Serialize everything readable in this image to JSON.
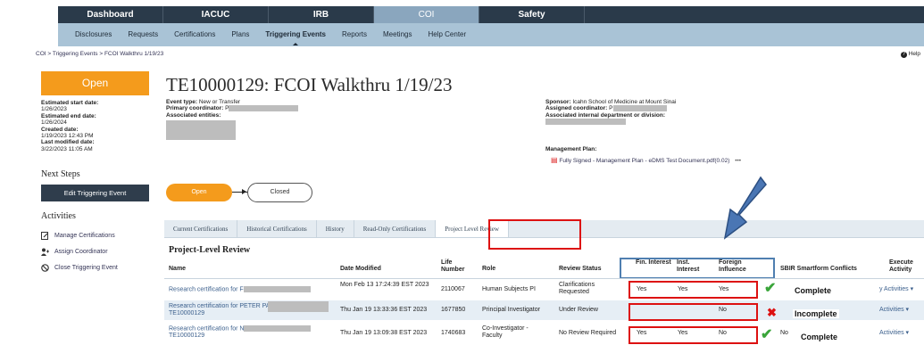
{
  "topnav": {
    "tabs": [
      "Dashboard",
      "IACUC",
      "IRB",
      "COI",
      "Safety"
    ],
    "active": "COI"
  },
  "subnav": {
    "items": [
      "Disclosures",
      "Requests",
      "Certifications",
      "Plans",
      "Triggering Events",
      "Reports",
      "Meetings",
      "Help Center"
    ],
    "active": "Triggering Events"
  },
  "breadcrumb": "COI > Triggering Events > FCOI Walkthru 1/19/23",
  "help_label": "Help",
  "state": "Open",
  "dates": {
    "estimated_start_label": "Estimated start date:",
    "estimated_start": "1/26/2023",
    "estimated_end_label": "Estimated end date:",
    "estimated_end": "1/26/2024",
    "created_label": "Created date:",
    "created": "1/19/2023 12:43 PM",
    "last_modified_label": "Last modified date:",
    "last_modified": "3/22/2023 11:05 AM"
  },
  "next_steps": {
    "heading": "Next Steps",
    "button": "Edit Triggering Event"
  },
  "activities": {
    "heading": "Activities",
    "items": [
      "Manage Certifications",
      "Assign Coordinator",
      "Close Triggering Event"
    ]
  },
  "header": {
    "title": "TE10000129: FCOI Walkthru 1/19/23",
    "event_type_label": "Event type:",
    "event_type": "New or Transfer",
    "primary_coordinator_label": "Primary coordinator:",
    "primary_coordinator": "P",
    "associated_entities_label": "Associated entities:",
    "sponsor_label": "Sponsor:",
    "sponsor": "Icahn School of Medicine at Mount Sinai",
    "assigned_coordinator_label": "Assigned coordinator:",
    "assigned_coordinator": "P",
    "associated_dept_label": "Associated internal department or division:"
  },
  "management_plan": {
    "heading": "Management Plan:",
    "file": "Fully Signed - Management Plan - eDMS Test Document.pdf(0.02)",
    "more": "•••"
  },
  "workflow": {
    "current": "Open",
    "next": "Closed"
  },
  "tabs": [
    "Current Certifications",
    "Historical Certifications",
    "History",
    "Read-Only Certifications",
    "Project Level Review"
  ],
  "active_tab": "Project Level Review",
  "section_heading": "Project-Level Review",
  "table": {
    "columns": {
      "name": "Name",
      "date": "Date Modified",
      "life_number": "Life Number",
      "role": "Role",
      "review_status": "Review Status",
      "fin": "Fin. Interest",
      "inst": "Inst. Interest",
      "foreign": "Foreign Influence",
      "sbir": "SBIR Smartform Conflicts",
      "execute": "Execute Activity"
    },
    "rows": [
      {
        "name": "Research certification for F",
        "name2": "",
        "date": "Mon Feb 13 17:24:39 EST 2023",
        "life_number": "2110067",
        "role": "Human Subjects PI",
        "review_status": "Clarifications Requested",
        "fin": "Yes",
        "inst": "Yes",
        "foreign": "Yes",
        "sbir": "",
        "execute": "y Activities ▾",
        "status_mark": "check",
        "status_label": "Complete"
      },
      {
        "name": "Research certification for PETER PAINES",
        "name2": "TE10000129",
        "date": "Thu Jan 19 13:33:36 EST 2023",
        "life_number": "1677850",
        "role": "Principal Investigator",
        "review_status": "Under Review",
        "fin": "",
        "inst": "",
        "foreign": "No",
        "sbir": "",
        "execute": "Activities ▾",
        "status_mark": "x",
        "status_label": "Incomplete"
      },
      {
        "name": "Research certification for N",
        "name2": "TE10000129",
        "date": "Thu Jan 19 13:09:38 EST 2023",
        "life_number": "1740683",
        "role": "Co-Investigator - Faculty",
        "review_status": "No Review Required",
        "fin": "Yes",
        "inst": "Yes",
        "foreign": "No",
        "sbir": "No",
        "execute": "Activities ▾",
        "status_mark": "check",
        "status_label": "Complete"
      }
    ]
  },
  "colors": {
    "nav_dark": "#2a3a4a",
    "subnav": "#a9c3d6",
    "accent_orange": "#f49b1c",
    "highlight_red": "#dd1111",
    "highlight_blue": "#4f7fb0",
    "complete_green": "#3aa53a"
  },
  "icons": {
    "help": "help-circle-icon",
    "pdf": "pdf-file-icon",
    "manage": "edit-document-icon",
    "assign": "assign-user-icon",
    "close": "ban-circle-icon",
    "annotation": "arrow-annotation-icon"
  }
}
